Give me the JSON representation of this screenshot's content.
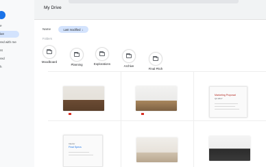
{
  "sidebar": {
    "items": [
      {
        "label": "e",
        "active": false
      },
      {
        "label": "ive",
        "active": true
      },
      {
        "label": "red with me",
        "active": false
      },
      {
        "label": "nt",
        "active": false
      },
      {
        "label": "red",
        "active": false
      },
      {
        "label": "h",
        "active": false
      }
    ]
  },
  "header": {
    "title": "My Drive"
  },
  "sort": {
    "label": "Name",
    "chip": "Last modified",
    "chip_icon": "↓"
  },
  "sections": {
    "folders_label": "Folders"
  },
  "folders": [
    {
      "name": "Moodboard",
      "icon": "folder-icon"
    },
    {
      "name": "Planning",
      "icon": "folder-icon"
    },
    {
      "name": "Explorations",
      "icon": "folder-icon"
    },
    {
      "name": "Archive",
      "icon": "folder-icon"
    },
    {
      "name": "Final Pitch",
      "icon": "folder-icon"
    }
  ],
  "files": [
    {
      "kind": "photo",
      "label": ""
    },
    {
      "kind": "photo",
      "label": ""
    },
    {
      "kind": "doc",
      "label": "Marketing Proposal",
      "sub": "Q4 2017"
    },
    {
      "kind": "doc",
      "label": "Final Specs",
      "sub": "Interior"
    },
    {
      "kind": "photo",
      "label": ""
    },
    {
      "kind": "photo",
      "label": ""
    }
  ],
  "colors": {
    "accent": "#1a73e8",
    "chip_bg": "#d3e3fd",
    "doc_accent": "#b3261e"
  }
}
